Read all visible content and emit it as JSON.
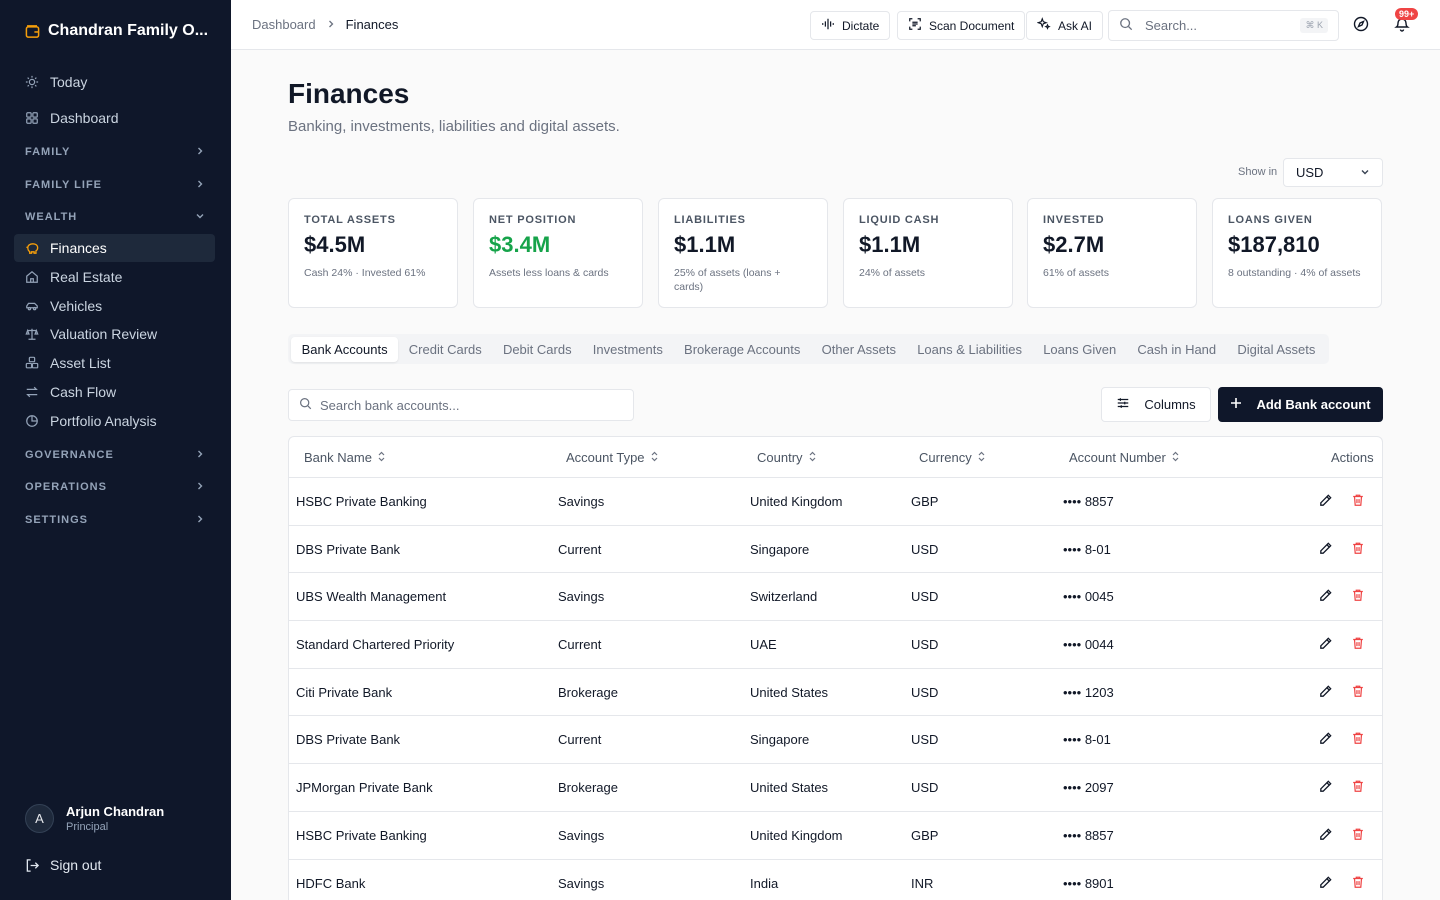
{
  "sidebar": {
    "brand": "Chandran Family O...",
    "today": "Today",
    "dashboard": "Dashboard",
    "sections": {
      "family": "FAMILY",
      "family_life": "FAMILY LIFE",
      "wealth": "WEALTH",
      "governance": "GOVERNANCE",
      "operations": "OPERATIONS",
      "settings": "SETTINGS"
    },
    "wealth_items": [
      "Finances",
      "Real Estate",
      "Vehicles",
      "Valuation Review",
      "Asset List",
      "Cash Flow",
      "Portfolio Analysis"
    ],
    "user": {
      "initial": "A",
      "name": "Arjun Chandran",
      "role": "Principal"
    },
    "signout": "Sign out"
  },
  "topbar": {
    "breadcrumb": [
      "Dashboard",
      "Finances"
    ],
    "dictate": "Dictate",
    "scan": "Scan Document",
    "ask_ai": "Ask AI",
    "search_placeholder": "Search...",
    "search_shortcut": "⌘ K",
    "notifications": "99+"
  },
  "page": {
    "title": "Finances",
    "subtitle": "Banking, investments, liabilities and digital assets.",
    "show_in_label": "Show in",
    "currency": "USD"
  },
  "cards": [
    {
      "label": "TOTAL ASSETS",
      "value": "$4.5M",
      "note": "Cash 24% · Invested 61%"
    },
    {
      "label": "NET POSITION",
      "value": "$3.4M",
      "note": "Assets less loans & cards"
    },
    {
      "label": "LIABILITIES",
      "value": "$1.1M",
      "note": "25% of assets (loans + cards)"
    },
    {
      "label": "LIQUID CASH",
      "value": "$1.1M",
      "note": "24% of assets"
    },
    {
      "label": "INVESTED",
      "value": "$2.7M",
      "note": "61% of assets"
    },
    {
      "label": "LOANS GIVEN",
      "value": "$187,810",
      "note": "8 outstanding · 4% of assets"
    }
  ],
  "colors": {
    "positive": "#16a34a",
    "danger": "#ef4444",
    "sidebar": "#0f172a"
  },
  "tabs": [
    "Bank Accounts",
    "Credit Cards",
    "Debit Cards",
    "Investments",
    "Brokerage Accounts",
    "Other Assets",
    "Loans & Liabilities",
    "Loans Given",
    "Cash in Hand",
    "Digital Assets"
  ],
  "toolbar": {
    "search_placeholder": "Search bank accounts...",
    "columns": "Columns",
    "add": "Add Bank account"
  },
  "table": {
    "headers": [
      "Bank Name",
      "Account Type",
      "Country",
      "Currency",
      "Account Number",
      "Actions"
    ],
    "rows": [
      [
        "HSBC Private Banking",
        "Savings",
        "United Kingdom",
        "GBP",
        "•••• 8857"
      ],
      [
        "DBS Private Bank",
        "Current",
        "Singapore",
        "USD",
        "•••• 8-01"
      ],
      [
        "UBS Wealth Management",
        "Savings",
        "Switzerland",
        "USD",
        "•••• 0045"
      ],
      [
        "Standard Chartered Priority",
        "Current",
        "UAE",
        "USD",
        "•••• 0044"
      ],
      [
        "Citi Private Bank",
        "Brokerage",
        "United States",
        "USD",
        "•••• 1203"
      ],
      [
        "DBS Private Bank",
        "Current",
        "Singapore",
        "USD",
        "•••• 8-01"
      ],
      [
        "JPMorgan Private Bank",
        "Brokerage",
        "United States",
        "USD",
        "•••• 2097"
      ],
      [
        "HSBC Private Banking",
        "Savings",
        "United Kingdom",
        "GBP",
        "•••• 8857"
      ],
      [
        "HDFC Bank",
        "Savings",
        "India",
        "INR",
        "•••• 8901"
      ]
    ]
  }
}
